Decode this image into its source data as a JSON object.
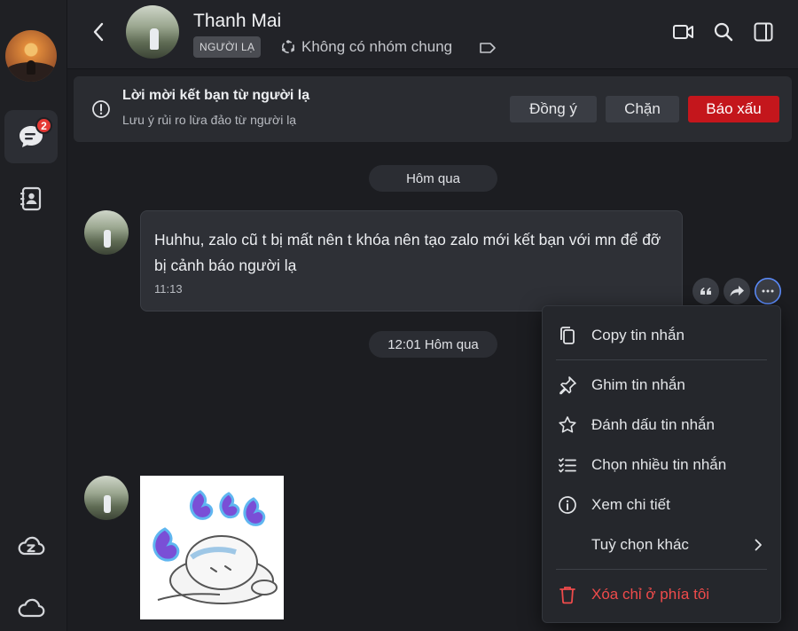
{
  "rail": {
    "messages_badge": "2"
  },
  "header": {
    "contact_name": "Thanh Mai",
    "stranger_tag": "NGƯỜI LẠ",
    "group_info": "Không có nhóm chung"
  },
  "banner": {
    "title": "Lời mời kết bạn từ người lạ",
    "note": "Lưu ý rủi ro lừa đảo từ người lạ",
    "accept_label": "Đồng ý",
    "block_label": "Chặn",
    "report_label": "Báo xấu"
  },
  "conversation": {
    "date_divider_1": "Hôm qua",
    "message_text": "Huhhu, zalo cũ t bị mất nên t khóa nên tạo zalo mới kết bạn với mn để đỡ bị cảnh báo người lạ",
    "message_time": "11:13",
    "date_divider_2": "12:01 Hôm qua"
  },
  "context_menu": {
    "items": [
      {
        "label": "Copy tin nhắn",
        "icon": "copy-icon"
      },
      {
        "label": "Ghim tin nhắn",
        "icon": "pin-icon"
      },
      {
        "label": "Đánh dấu tin nhắn",
        "icon": "star-icon"
      },
      {
        "label": "Chọn nhiều tin nhắn",
        "icon": "multi-select-icon"
      },
      {
        "label": "Xem chi tiết",
        "icon": "info-icon"
      },
      {
        "label": "Tuỳ chọn khác",
        "icon": "chevron-right-icon"
      },
      {
        "label": "Xóa chỉ ở phía tôi",
        "icon": "trash-icon"
      }
    ]
  },
  "colors": {
    "background": "#1c1d21",
    "danger": "#c4161c",
    "badge": "#e53935"
  }
}
